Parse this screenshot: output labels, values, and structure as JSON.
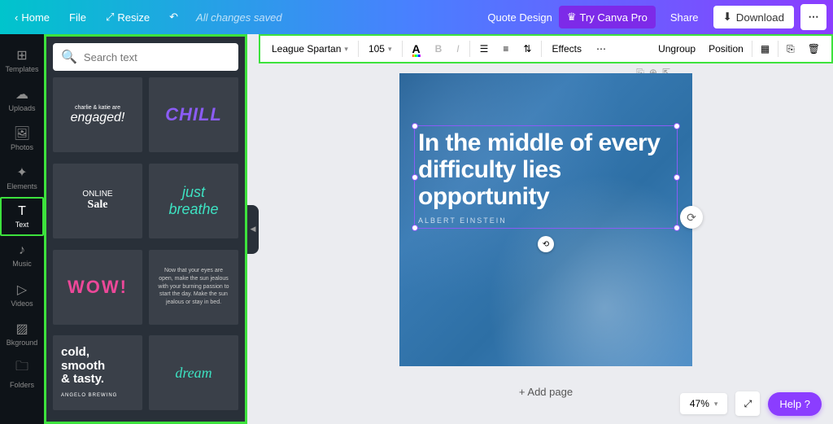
{
  "topbar": {
    "home": "Home",
    "file": "File",
    "resize": "Resize",
    "status": "All changes saved",
    "title": "Quote Design",
    "try_pro": "Try Canva Pro",
    "share": "Share",
    "download": "Download"
  },
  "far_sidebar": [
    {
      "label": "Templates",
      "icon": "⊞"
    },
    {
      "label": "Uploads",
      "icon": "☁"
    },
    {
      "label": "Photos",
      "icon": "🖼"
    },
    {
      "label": "Elements",
      "icon": "✦"
    },
    {
      "label": "Text",
      "icon": "T"
    },
    {
      "label": "Music",
      "icon": "♪"
    },
    {
      "label": "Videos",
      "icon": "▷"
    },
    {
      "label": "Bkground",
      "icon": "▨"
    },
    {
      "label": "Folders",
      "icon": "🗀"
    }
  ],
  "search": {
    "placeholder": "Search text"
  },
  "templates": {
    "t1_small": "charlie & katie are",
    "t1_main": "engaged!",
    "t2": "CHILL",
    "t3_top": "ONLINE",
    "t3_main": "Sale",
    "t4_l1": "just",
    "t4_l2": "breathe",
    "t5": "WOW!",
    "t6": "Now that your eyes are open, make the sun jealous with your burning passion to start the day. Make the sun jealous or stay in bed.",
    "t7_l1": "cold,",
    "t7_l2": "smooth",
    "t7_l3": "& tasty.",
    "t7_small": "ANGELO BREWING",
    "t8": "dream"
  },
  "toolbar": {
    "font": "League Spartan",
    "size": "105",
    "effects": "Effects",
    "ungroup": "Ungroup",
    "position": "Position"
  },
  "canvas": {
    "quote": "In the middle of every difficulty lies opportunity",
    "author": "ALBERT EINSTEIN",
    "add_page": "+ Add page"
  },
  "footer": {
    "zoom": "47%",
    "help": "Help ?"
  }
}
